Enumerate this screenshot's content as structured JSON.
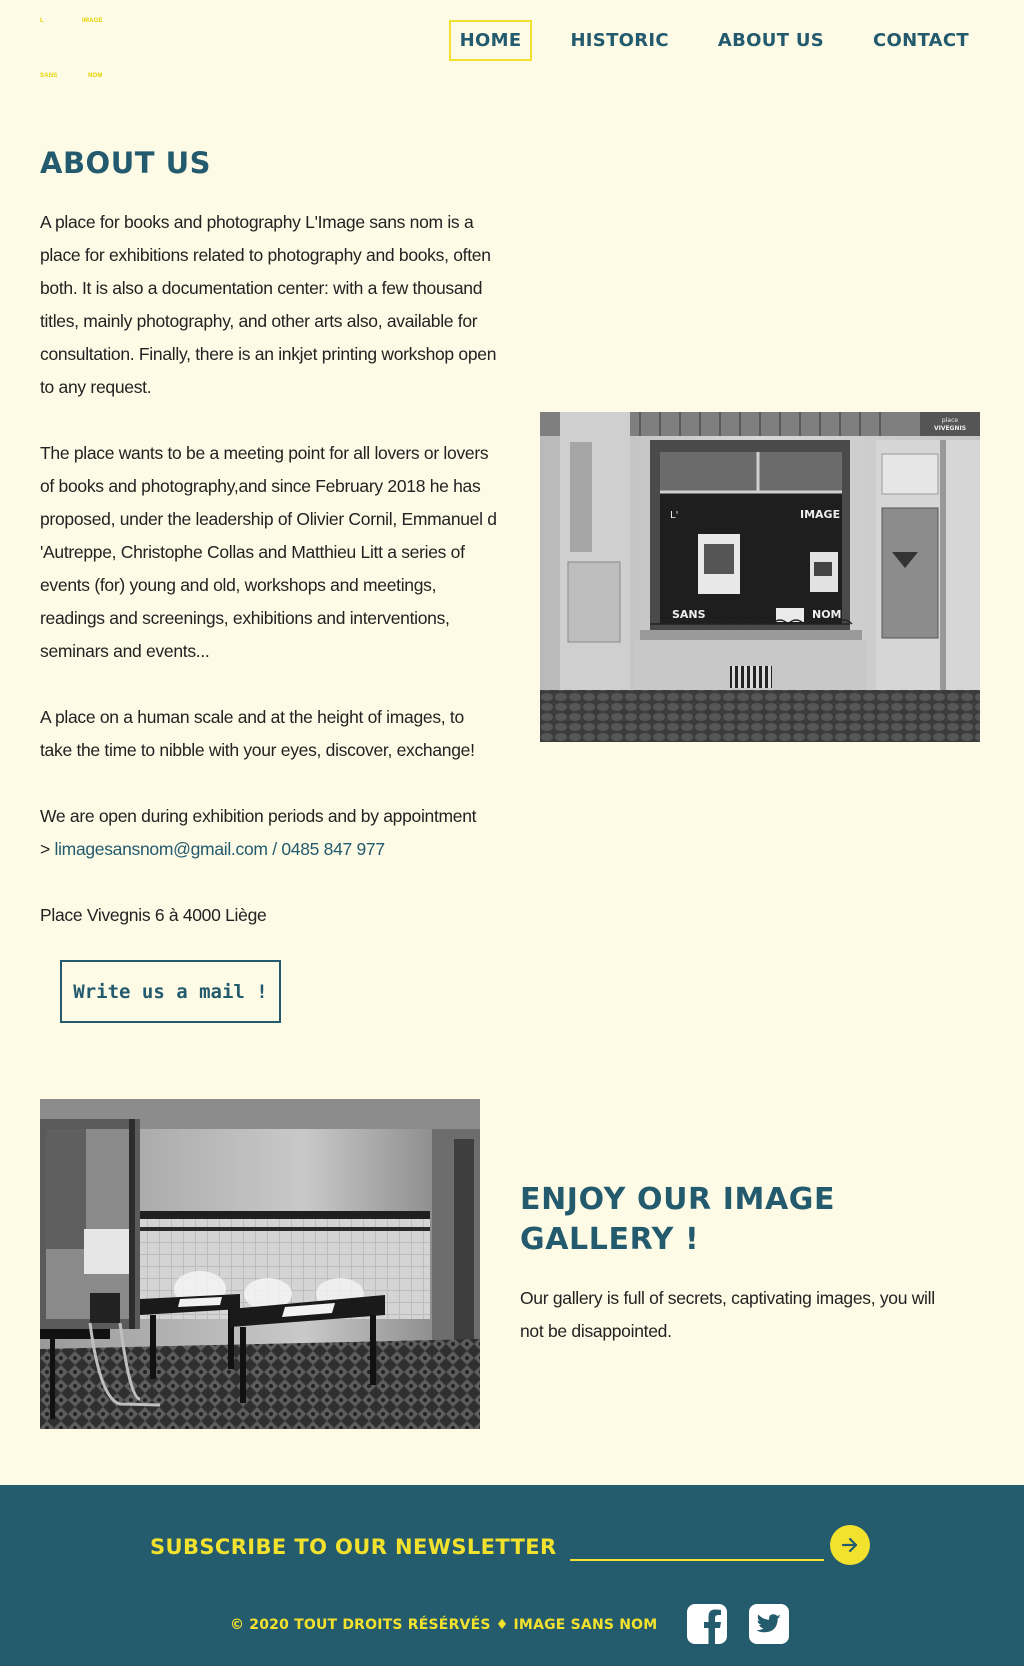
{
  "header": {
    "logo": {
      "top_left": "L",
      "top_right": "IMAGE",
      "bottom_left": "SANS",
      "bottom_right": "NOM"
    },
    "nav": [
      {
        "label": "HOME",
        "active": true
      },
      {
        "label": "HISTORIC",
        "active": false
      },
      {
        "label": "ABOUT US",
        "active": false
      },
      {
        "label": "CONTACT",
        "active": false
      }
    ]
  },
  "about": {
    "title": "ABOUT US",
    "paragraph1": " A place for books and photography L'Image sans nom is a place for exhibitions related to photography and books, often both. It is also a documentation center: with a few thousand titles, mainly photography, and other arts also, available for consultation. Finally, there is an inkjet printing workshop open to any request.",
    "paragraph2": "The place wants to be a meeting point for all lovers or lovers of books and photography,and since February 2018 he has proposed, under the leadership of Olivier Cornil, Emmanuel d 'Autreppe, Christophe Collas and Matthieu Litt a series of events (for) young and old, workshops and meetings, readings and screenings, exhibitions and interventions, seminars and events...",
    "paragraph3": "A place on a human scale and at the height of images, to take the time to nibble with your eyes, discover, exchange!",
    "paragraph4": "We are open during exhibition periods and by appointment",
    "contact_prefix": "> ",
    "email": "limagesansnom@gmail.com",
    "separator": " / ",
    "phone": "0485 847 977",
    "address": "Place Vivegnis 6 à 4000 Liège",
    "button_label": "Write us a mail !"
  },
  "storefront_photo": {
    "window_text": {
      "image": "IMAGE",
      "sans": "SANS",
      "nom": "NOM",
      "l": "L'"
    },
    "street_sign": [
      "place",
      "VIVEGNIS"
    ]
  },
  "gallery": {
    "title": "ENJOY OUR IMAGE GALLERY !",
    "text": "Our gallery is full of secrets, captivating images, you will not be disappointed."
  },
  "footer": {
    "newsletter_label": "SUBSCRIBE TO OUR NEWSLETTER",
    "newsletter_placeholder": "",
    "submit_icon": "arrow-right-icon",
    "copyright": "© 2020 TOUT DROITS RÉSÉRVÉS ♦ IMAGE SANS NOM",
    "social": [
      "facebook-icon",
      "twitter-icon"
    ]
  },
  "colors": {
    "background": "#fdfbe6",
    "primary": "#235a6e",
    "accent": "#f3e22d",
    "footer": "#245b6d"
  }
}
